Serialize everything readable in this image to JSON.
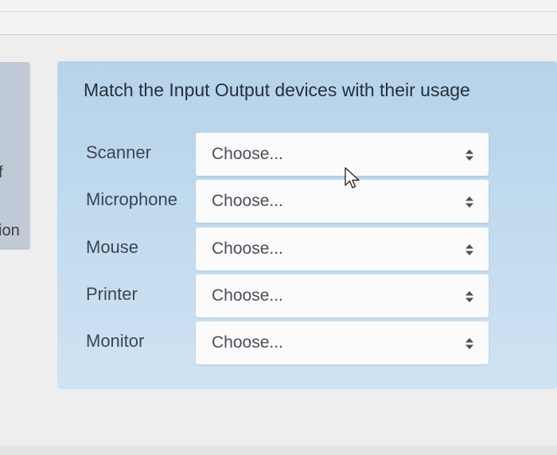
{
  "sidebar": {
    "fragment_top": "f",
    "fragment_bottom": "ion"
  },
  "question": {
    "title": "Match the Input Output devices with their usage",
    "rows": [
      {
        "label": "Scanner",
        "selected": "Choose..."
      },
      {
        "label": "Microphone",
        "selected": "Choose..."
      },
      {
        "label": "Mouse",
        "selected": "Choose..."
      },
      {
        "label": "Printer",
        "selected": "Choose..."
      },
      {
        "label": "Monitor",
        "selected": "Choose..."
      }
    ]
  },
  "icons": {
    "select_arrow": "up-down-arrow-icon",
    "cursor": "mouse-pointer-icon"
  },
  "colors": {
    "card_background": "#b6d3ea",
    "select_background": "#fbfbfc",
    "title_text": "#24313f"
  }
}
